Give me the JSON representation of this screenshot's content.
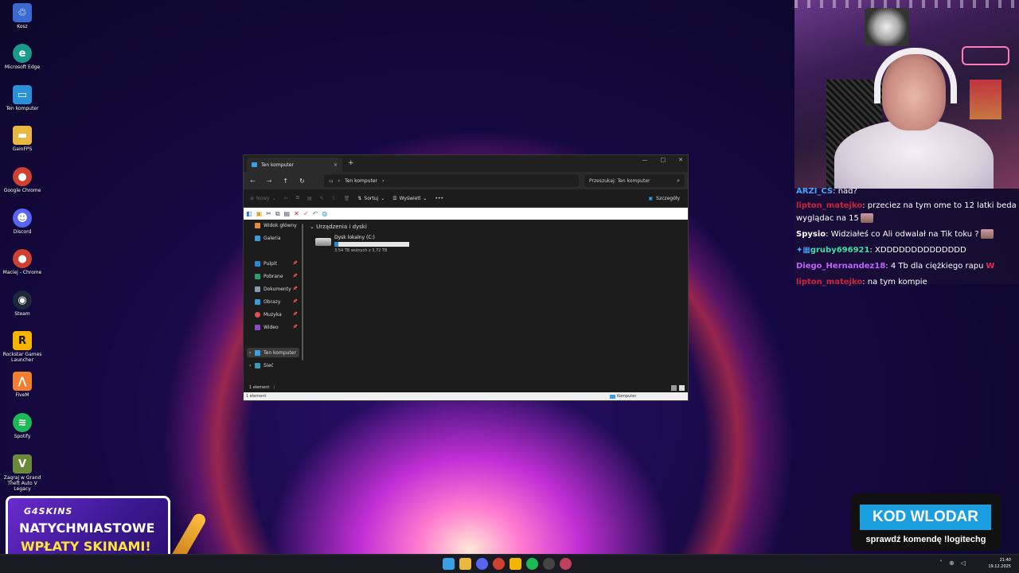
{
  "desktop": {
    "icons": [
      {
        "label": "Kosz",
        "icon": "recycle-bin-icon",
        "color": "#3a6ad0"
      },
      {
        "label": "Microsoft Edge",
        "icon": "edge-icon",
        "color": "#1a9a8a"
      },
      {
        "label": "Ten komputer",
        "icon": "computer-icon",
        "color": "#2a90d8"
      },
      {
        "label": "GainFPS",
        "icon": "folder-icon",
        "color": "#e8b840"
      },
      {
        "label": "Google Chrome",
        "icon": "chrome-icon",
        "color": "#d04030"
      },
      {
        "label": "Discord",
        "icon": "discord-icon",
        "color": "#5865f2"
      },
      {
        "label": "Maciej - Chrome",
        "icon": "chrome-icon",
        "color": "#d04030"
      },
      {
        "label": "Steam",
        "icon": "steam-icon",
        "color": "#1b2838"
      },
      {
        "label": "Rockstar Games Launcher",
        "icon": "rockstar-icon",
        "color": "#f5b400"
      },
      {
        "label": "FiveM",
        "icon": "fivem-icon",
        "color": "#f08030"
      },
      {
        "label": "Spotify",
        "icon": "spotify-icon",
        "color": "#1db954"
      },
      {
        "label": "Zagraj w Grand Theft Auto V Legacy",
        "icon": "gta-icon",
        "color": "#6a8a3a"
      }
    ]
  },
  "explorer": {
    "tab_title": "Ten komputer",
    "tab_close": "×",
    "new_tab": "+",
    "address": "Ten komputer",
    "search_placeholder": "Przeszukaj: Ten komputer",
    "commands": {
      "new": "Nowy",
      "sort": "Sortuj",
      "view": "Wyświetl",
      "more": "•••",
      "details": "Szczegóły"
    },
    "sidebar": {
      "home": "Widok główny",
      "gallery": "Galeria",
      "desktop": "Pulpit",
      "downloads": "Pobrane",
      "documents": "Dokumenty",
      "pictures": "Obrazy",
      "music": "Muzyka",
      "videos": "Wideo",
      "this_pc": "Ten komputer",
      "network": "Sieć"
    },
    "section_title": "Urządzenia i dyski",
    "drive": {
      "name": "Dysk lokalny (C:)",
      "free_text": "3,54 TB wolnych z 3,72 TB",
      "used_fraction": 0.05
    },
    "status": "1 element",
    "legacy_status_left": "1 element",
    "legacy_status_right": "Komputer"
  },
  "chat": [
    {
      "user": "ARZI_CS",
      "user_color": "#4aa0ff",
      "text": ": nad?",
      "emote": false
    },
    {
      "user": "lipton_matejko",
      "user_color": "#d02040",
      "text": ": przeciez na tym ome to 12 latki beda",
      "emote": false
    },
    {
      "user": "",
      "user_color": "#ffffff",
      "text": "wyglądac na 15",
      "emote": true
    },
    {
      "user": "Spysio",
      "user_color": "#ffffff",
      "text": ": Widziałeś co Ali odwalał na Tik toku ?",
      "emote": true
    },
    {
      "user": "gruby696921",
      "user_color": "#40e0a0",
      "text": ": XDDDDDDDDDDDDDD",
      "emote": false
    },
    {
      "user": "Diego_Hernandez18",
      "user_color": "#c060ff",
      "text": ": 4 Tb dla ciężkiego rapu",
      "emote": false
    },
    {
      "user": "lipton_matejko",
      "user_color": "#d02040",
      "text": ": na tym kompie",
      "emote": false
    }
  ],
  "promo": {
    "brand": "G4SKINS",
    "line1": "NATYCHMIASTOWE",
    "line2": "WPŁATY SKINAMI!"
  },
  "code_box": {
    "code": "KOD WLODAR",
    "hint": "sprawdź komendę !logitechg"
  },
  "taskbar": {
    "time": "21:40",
    "date": "19.12.2025"
  }
}
